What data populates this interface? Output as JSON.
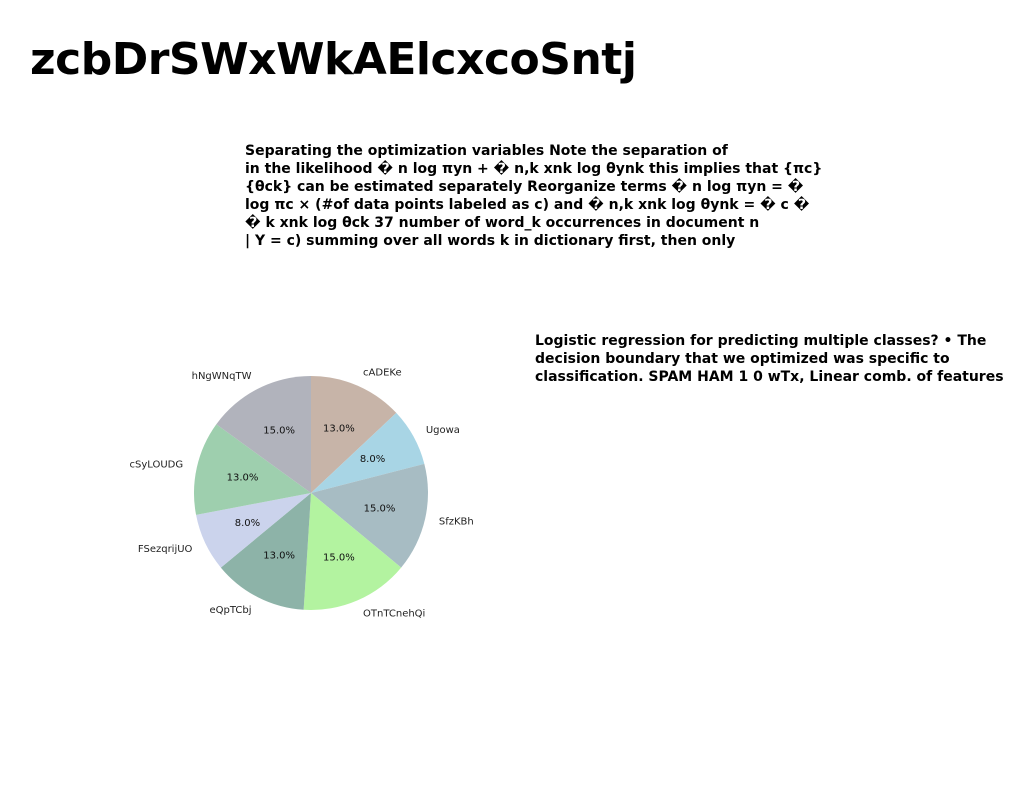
{
  "page": {
    "title": "zcbDrSWxWkAElcxcoSntj"
  },
  "text_blocks": [
    {
      "lines": [
        "Separating the optimization variables Note the separation of",
        "in the likelihood � n log πyn + � n,k xnk log θynk this implies that {πc}",
        "{θck} can be estimated separately Reorganize terms � n log πyn = �",
        "log πc × (#of data points labeled as c) and � n,k xnk log θynk = � c �",
        "� k xnk log θck 37 number of word_k occurrences in document n",
        "| Y = c) summing over all words k in dictionary first, then only"
      ]
    },
    {
      "lines": [
        "Logistic regression for predicting multiple classes? • The",
        "decision boundary that we optimized was specific to",
        "classification. SPAM HAM 1 0 wTx, Linear comb. of features"
      ]
    }
  ],
  "chart_data": {
    "type": "pie",
    "start_angle_deg": 90,
    "direction": "clockwise",
    "categories": [
      "cADEKe",
      "Ugowa",
      "SfzKBh",
      "OTnTCnehQi",
      "eQpTCbj",
      "FSezqrijUO",
      "cSyLOUDG",
      "hNgWNqTW"
    ],
    "values": [
      13.0,
      8.0,
      15.0,
      15.0,
      13.0,
      8.0,
      13.0,
      15.0
    ],
    "value_labels": [
      "13.0%",
      "8.0%",
      "15.0%",
      "15.0%",
      "13.0%",
      "8.0%",
      "13.0%",
      "15.0%"
    ],
    "colors": [
      "#c7b4a8",
      "#a8d5e5",
      "#a7bcc3",
      "#b3f3a0",
      "#8db3a8",
      "#cbd3ec",
      "#9ecfae",
      "#b1b3bc"
    ]
  }
}
